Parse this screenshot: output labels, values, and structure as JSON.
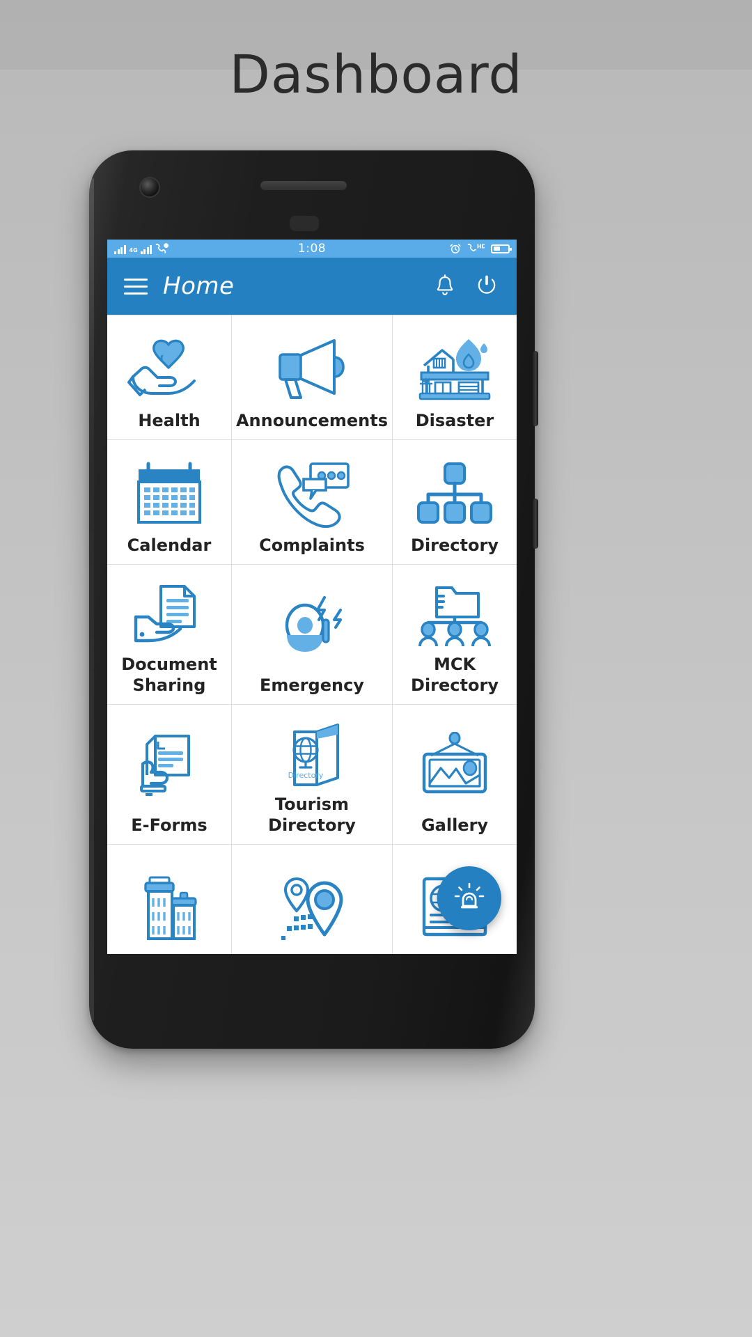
{
  "page": {
    "title": "Dashboard",
    "background_color": "#c2c2c2"
  },
  "colors": {
    "appbar_blue": "#2480c0",
    "statusbar_blue": "#5aace8",
    "icon_blue_stroke": "#2a83c3",
    "icon_blue_fill": "#62b0e5",
    "fab_blue": "#2480c0",
    "tile_divider": "#dedede",
    "label_text": "#232323"
  },
  "statusbar": {
    "time": "1:08",
    "left_icons": [
      "signal-bars-icon",
      "signal-4g-icon",
      "call-message-icon"
    ],
    "network_label": "4G",
    "right_icons": [
      "alarm-clock-icon",
      "volte-hd-call-icon",
      "battery-icon"
    ],
    "volte_label": "HD",
    "battery_level_percent": 45
  },
  "appbar": {
    "menu_icon": "hamburger-menu-icon",
    "title": "Home",
    "actions": [
      {
        "name": "notifications-bell-icon",
        "label": "Notifications"
      },
      {
        "name": "power-logout-icon",
        "label": "Logout"
      }
    ]
  },
  "grid": {
    "columns": 3,
    "tiles": [
      {
        "label": "Health",
        "icon": "heart-in-hand-icon"
      },
      {
        "label": "Announcements",
        "icon": "megaphone-icon"
      },
      {
        "label": "Disaster",
        "icon": "house-on-fire-icon"
      },
      {
        "label": "Calendar",
        "icon": "calendar-icon"
      },
      {
        "label": "Complaints",
        "icon": "phone-chat-icon"
      },
      {
        "label": "Directory",
        "icon": "org-chart-icon"
      },
      {
        "label": "Document Sharing",
        "icon": "document-in-hand-icon"
      },
      {
        "label": "Emergency",
        "icon": "alarm-bell-icon"
      },
      {
        "label": "MCK Directory",
        "icon": "folder-people-icon"
      },
      {
        "label": "E-Forms",
        "icon": "hand-holding-form-icon"
      },
      {
        "label": "Tourism Directory",
        "icon": "brochure-globe-icon",
        "icon_text": "Directory"
      },
      {
        "label": "Gallery",
        "icon": "framed-picture-icon"
      },
      {
        "label": "",
        "icon": "buildings-icon"
      },
      {
        "label": "",
        "icon": "map-pins-icon"
      },
      {
        "label": "",
        "icon": "globe-news-icon"
      }
    ]
  },
  "fab": {
    "icon": "emergency-siren-icon",
    "label": "Emergency Alert"
  }
}
